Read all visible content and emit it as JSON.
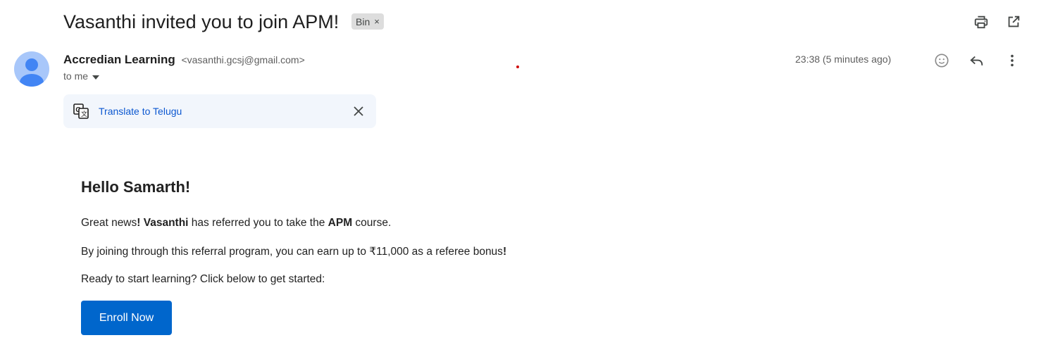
{
  "email": {
    "subject": "Vasanthi invited you to join APM!",
    "label_chip": "Bin",
    "label_remove": "×",
    "sender_name": "Accredian Learning",
    "sender_email": "<vasanthi.gcsj@gmail.com>",
    "recipient_summary": "to me",
    "timestamp": "23:38 (5 minutes ago)"
  },
  "icons": {
    "print": "print-icon",
    "open_new_window": "open-in-new-window-icon",
    "emoji": "emoji-reaction-icon",
    "reply": "reply-icon",
    "more": "more-vertical-icon",
    "translate": "translate-icon",
    "close": "close-icon",
    "avatar": "default-avatar-icon"
  },
  "translate_bar": {
    "link": "Translate to Telugu"
  },
  "body": {
    "greeting": "Hello Samarth!",
    "p1_a": "Great news",
    "p1_b": "! ",
    "p1_name": "Vasanthi",
    "p1_c": " has referred you to take the ",
    "p1_course": "APM",
    "p1_d": " course.",
    "p2_a": "By joining through this referral program, you can earn up to ₹11,000 as a referee bonus",
    "p2_b": "!",
    "p3": "Ready to start learning? Click below to get started:",
    "cta": "Enroll Now"
  },
  "colors": {
    "accent_link": "#0b57d0",
    "cta_background": "#0066cc",
    "avatar_bg": "#a8c7fa",
    "avatar_fg": "#4285f4"
  }
}
